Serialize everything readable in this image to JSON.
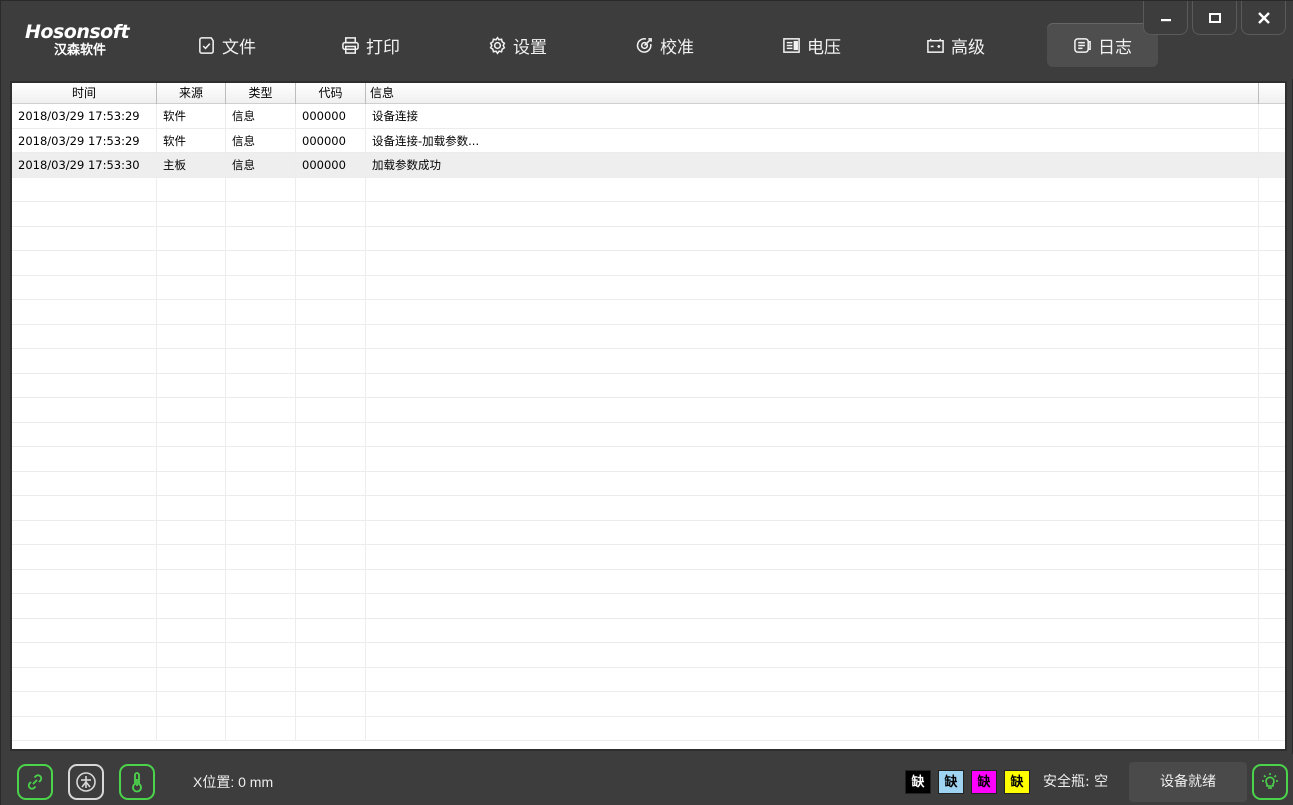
{
  "logo": {
    "main": "Hosonsoft",
    "sub": "汉森软件"
  },
  "nav": [
    {
      "label": "文件",
      "icon": "file-check-icon"
    },
    {
      "label": "打印",
      "icon": "printer-icon"
    },
    {
      "label": "设置",
      "icon": "gear-icon"
    },
    {
      "label": "校准",
      "icon": "calibrate-icon"
    },
    {
      "label": "电压",
      "icon": "voltage-icon"
    },
    {
      "label": "高级",
      "icon": "advanced-icon"
    },
    {
      "label": "日志",
      "icon": "log-icon",
      "active": true
    }
  ],
  "window_controls": [
    "minimize-icon",
    "maximize-icon",
    "close-icon"
  ],
  "table": {
    "headers": {
      "time": "时间",
      "source": "来源",
      "type": "类型",
      "code": "代码",
      "info": "信息"
    },
    "rows": [
      {
        "time": "2018/03/29 17:53:29",
        "source": "软件",
        "type": "信息",
        "code": "000000",
        "info": "设备连接"
      },
      {
        "time": "2018/03/29 17:53:29",
        "source": "软件",
        "type": "信息",
        "code": "000000",
        "info": "设备连接-加载参数..."
      },
      {
        "time": "2018/03/29 17:53:30",
        "source": "主板",
        "type": "信息",
        "code": "000000",
        "info": "加载参数成功"
      }
    ]
  },
  "status": {
    "x_position": "X位置: 0 mm",
    "inks": [
      {
        "label": "缺",
        "bg": "#000000",
        "fg": "#ffffff"
      },
      {
        "label": "缺",
        "bg": "#9fd3f2",
        "fg": "#000000"
      },
      {
        "label": "缺",
        "bg": "#ff00ff",
        "fg": "#000000"
      },
      {
        "label": "缺",
        "bg": "#ffff00",
        "fg": "#000000"
      }
    ],
    "safety_bottle": "安全瓶: 空",
    "device_state": "设备就绪"
  },
  "colors": {
    "accent_green": "#4bd34b",
    "background": "#3d3d3d"
  }
}
